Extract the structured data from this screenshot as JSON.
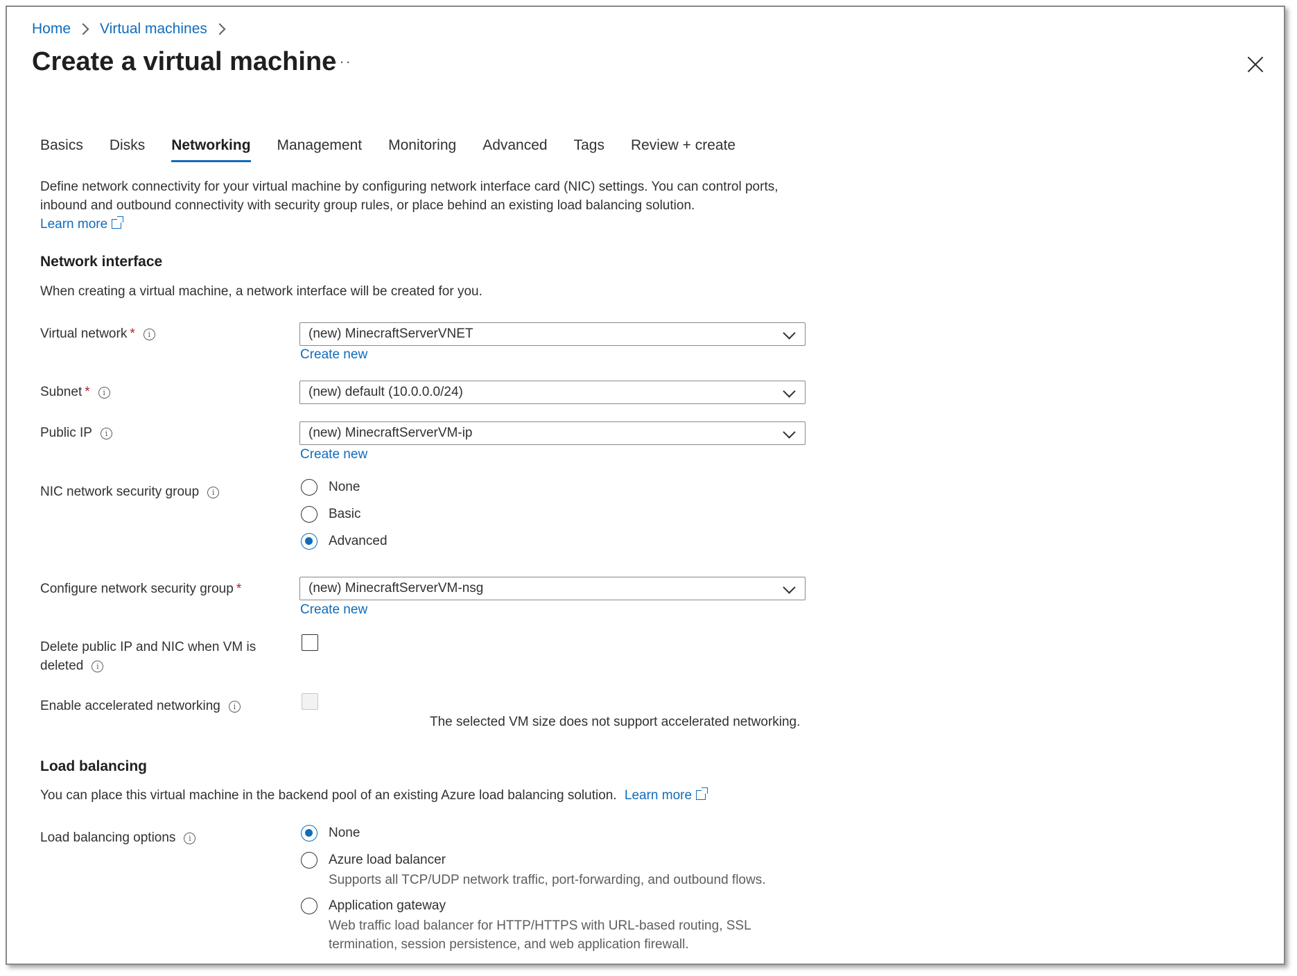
{
  "breadcrumb": {
    "home": "Home",
    "virtual_machines": "Virtual machines"
  },
  "header": {
    "title": "Create a virtual machine",
    "more": "···"
  },
  "tabs": [
    {
      "label": "Basics"
    },
    {
      "label": "Disks"
    },
    {
      "label": "Networking",
      "active": true
    },
    {
      "label": "Management"
    },
    {
      "label": "Monitoring"
    },
    {
      "label": "Advanced"
    },
    {
      "label": "Tags"
    },
    {
      "label": "Review + create"
    }
  ],
  "intro": {
    "line1": "Define network connectivity for your virtual machine by configuring network interface card (NIC) settings. You can control ports,",
    "line2": "inbound and outbound connectivity with security group rules, or place behind an existing load balancing solution.",
    "learn_more": "Learn more"
  },
  "network_interface": {
    "title": "Network interface",
    "description": "When creating a virtual machine, a network interface will be created for you.",
    "virtual_network": {
      "label": "Virtual network",
      "value": "(new) MinecraftServerVNET",
      "create_new": "Create new"
    },
    "subnet": {
      "label": "Subnet",
      "value": "(new) default (10.0.0.0/24)"
    },
    "public_ip": {
      "label": "Public IP",
      "value": "(new) MinecraftServerVM-ip",
      "create_new": "Create new"
    },
    "nic_nsg": {
      "label": "NIC network security group",
      "options": [
        "None",
        "Basic",
        "Advanced"
      ],
      "selected": "Advanced"
    },
    "configure_nsg": {
      "label": "Configure network security group",
      "value": "(new) MinecraftServerVM-nsg",
      "create_new": "Create new"
    },
    "delete_public_ip": {
      "label_line1": "Delete public IP and NIC when VM is",
      "label_line2": "deleted",
      "checked": false
    },
    "accelerated": {
      "label": "Enable accelerated networking",
      "checked": false,
      "disabled": true,
      "note": "The selected VM size does not support accelerated networking."
    }
  },
  "load_balancing": {
    "title": "Load balancing",
    "description": "You can place this virtual machine in the backend pool of an existing Azure load balancing solution.",
    "learn_more": "Learn more",
    "options_label": "Load balancing options",
    "options": [
      {
        "label": "None",
        "sub": ""
      },
      {
        "label": "Azure load balancer",
        "sub": "Supports all TCP/UDP network traffic, port-forwarding, and outbound flows."
      },
      {
        "label": "Application gateway",
        "sub1": "Web traffic load balancer for HTTP/HTTPS with URL-based routing, SSL",
        "sub2": "termination, session persistence, and web application firewall."
      }
    ],
    "selected": "None"
  },
  "colors": {
    "accent": "#0f6cbd",
    "required": "#a4262c",
    "text": "#323130"
  },
  "icons": {
    "info": "info-icon",
    "chevron": "chevron-down-icon",
    "close": "close-icon",
    "external": "external-link-icon"
  }
}
